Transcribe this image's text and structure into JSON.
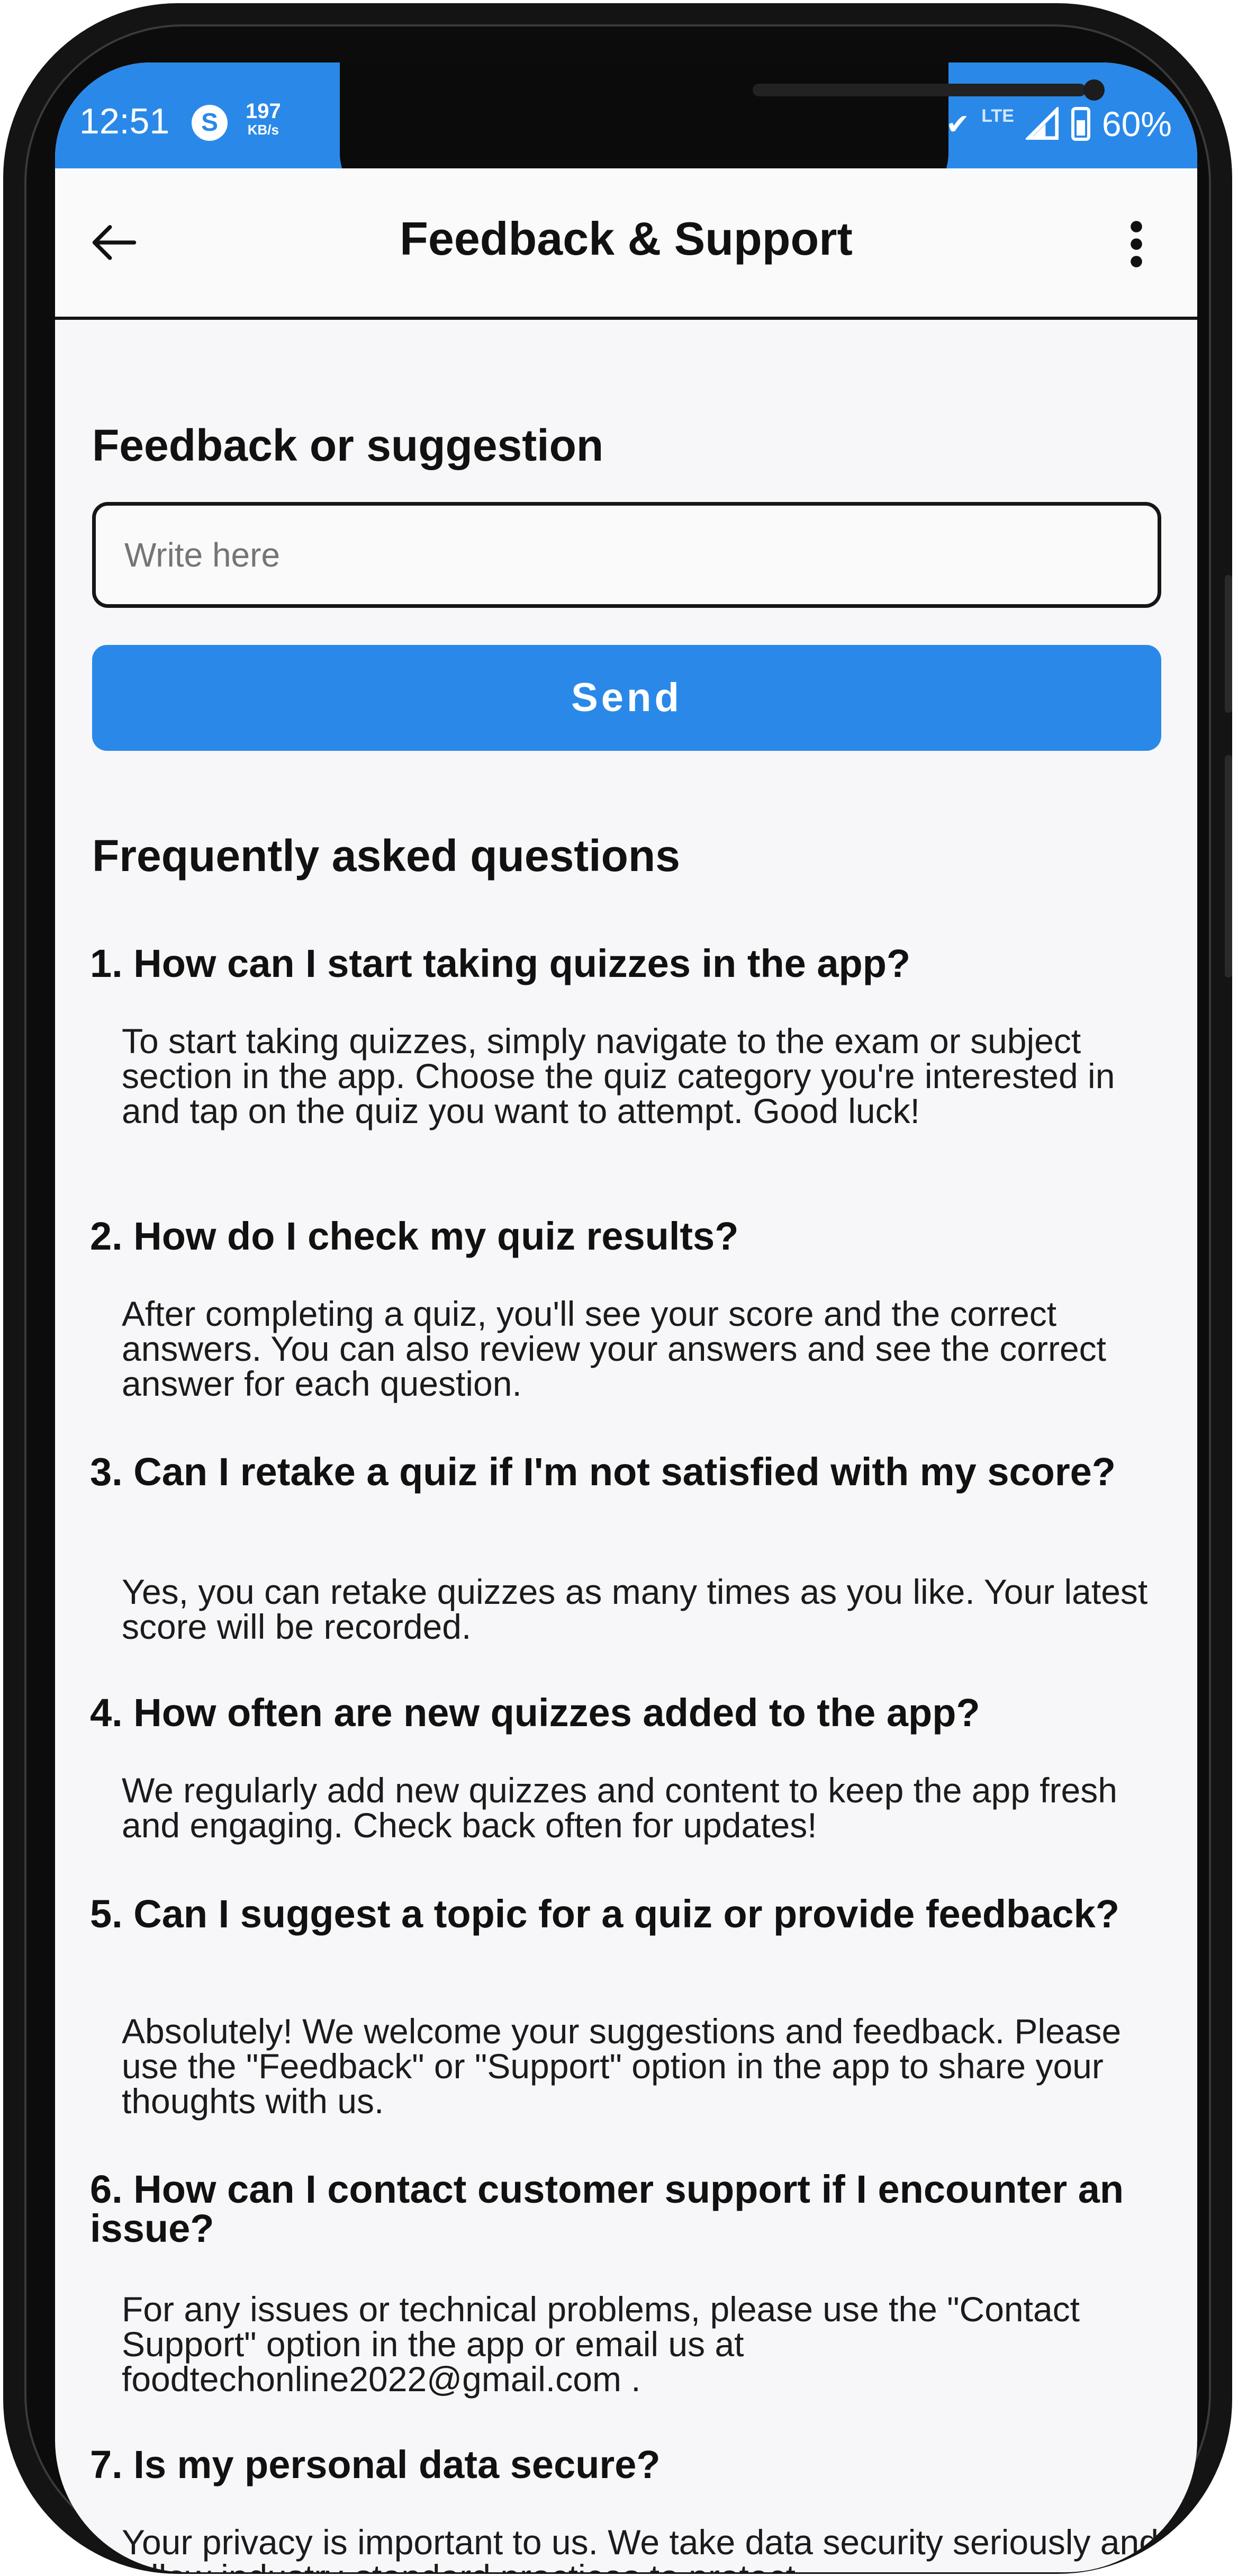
{
  "status_bar": {
    "time": "12:51",
    "badge": "S",
    "speed_value": "197",
    "speed_unit": "KB/s",
    "network": "LTE",
    "battery": "60%"
  },
  "app_bar": {
    "title": "Feedback & Support",
    "back_icon": "arrow-left-icon",
    "menu_icon": "more-vertical-icon"
  },
  "feedback": {
    "heading": "Feedback or suggestion",
    "placeholder": "Write here",
    "send_label": "Send"
  },
  "faq": {
    "heading": "Frequently asked questions",
    "items": [
      {
        "question": "1. How can I start taking quizzes in the app?",
        "answer": "To start taking quizzes, simply navigate to the exam or subject section in the app. Choose the quiz category you're interested in and tap on the quiz you want to attempt. Good luck!"
      },
      {
        "question": "2. How do I check my quiz results?",
        "answer": "After completing a quiz, you'll see your score and the correct answers. You can also review your answers and see the correct answer for each question."
      },
      {
        "question": "3. Can I retake a quiz if I'm not satisfied with my score?",
        "answer": "Yes, you can retake quizzes as many times as you like. Your latest score will be recorded."
      },
      {
        "question": "4. How often are new quizzes added to the app?",
        "answer": "We regularly add new quizzes and content to keep the app fresh and engaging. Check back often for updates!"
      },
      {
        "question": "5. Can I suggest a topic for a quiz or provide feedback?",
        "answer": "Absolutely! We welcome your suggestions and feedback. Please use the \"Feedback\" or \"Support\" option in the app to share your thoughts with us."
      },
      {
        "question": "6. How can I contact customer support if I encounter an issue?",
        "answer": "For any issues or technical problems, please use the \"Contact Support\" option in the app or email us at foodtechonline2022@gmail.com ."
      },
      {
        "question": "7. Is my personal data secure?",
        "answer": "Your privacy is important to us. We take data security seriously and follow industry-standard practices to protect"
      }
    ]
  },
  "colors": {
    "accent": "#2a89e8",
    "screen_background": "#f7f7f9",
    "text": "#111111"
  }
}
